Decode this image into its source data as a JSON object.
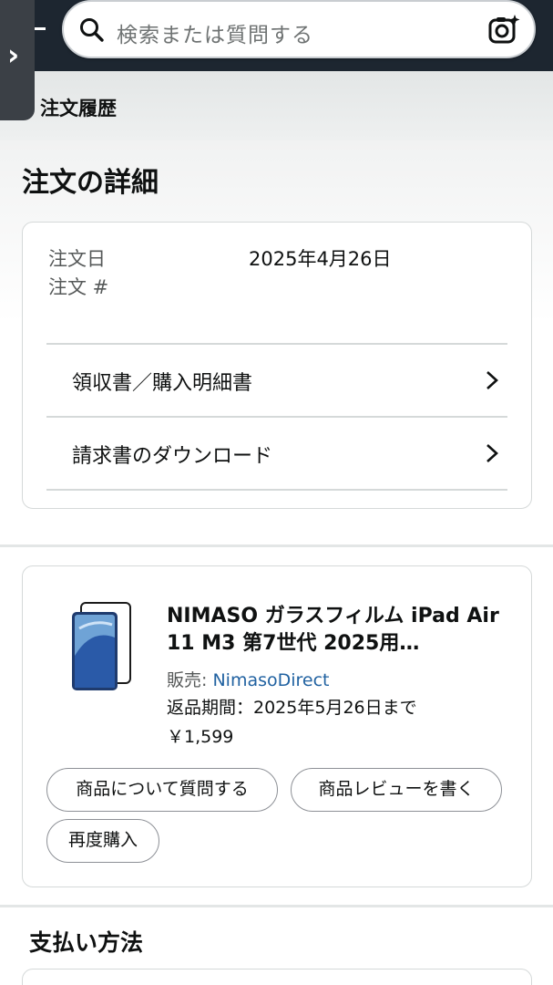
{
  "header": {
    "search_placeholder": "検索または質問する",
    "icons": [
      "chevron-right-icon",
      "search-icon",
      "camera-icon"
    ]
  },
  "breadcrumb": "注文履歴",
  "page_title": "注文の詳細",
  "order_info": {
    "date_label": "注文日",
    "date_value": "2025年4月26日",
    "number_label": "注文 #",
    "links": [
      {
        "label": "領収書／購入明細書"
      },
      {
        "label": "請求書のダウンロード"
      }
    ]
  },
  "item": {
    "title": "NIMASO ガラスフィルム iPad Air 11 M3 第7世代 2025用…",
    "seller_label": "販売: ",
    "seller_name": "NimasoDirect",
    "return_period": "返品期間：2025年5月26日まで",
    "price": "￥1,599",
    "buttons": {
      "ask": "商品について質問する",
      "review": "商品レビューを書く",
      "rebuy": "再度購入"
    }
  },
  "payment": {
    "title": "支払い方法"
  },
  "colors": {
    "header_bg": "#1d2630",
    "link": "#2162a1",
    "border": "#d5d9d9"
  }
}
